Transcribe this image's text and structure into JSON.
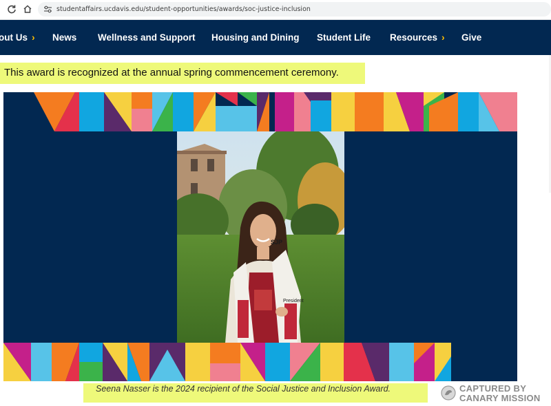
{
  "browser": {
    "url": "studentaffairs.ucdavis.edu/student-opportunities/awards/soc-justice-inclusion",
    "reload_icon": "reload-icon",
    "home_icon": "home-icon",
    "site_settings_icon": "tune-icon"
  },
  "nav": {
    "items": [
      {
        "label": "out Us",
        "has_chevron": true
      },
      {
        "label": "News",
        "has_chevron": false
      },
      {
        "label": "Wellness and Support",
        "has_chevron": false
      },
      {
        "label": "Housing and Dining",
        "has_chevron": false
      },
      {
        "label": "Student Life",
        "has_chevron": false
      },
      {
        "label": "Resources",
        "has_chevron": true
      },
      {
        "label": "Give",
        "has_chevron": false
      }
    ],
    "chevron": "›",
    "bg_color": "#022851",
    "chevron_color": "#ffbf00"
  },
  "content": {
    "intro": "This award is recognized at the annual spring commencement ceremony.",
    "caption": "Seena Nasser is the 2024 recipient of the Social Justice and Inclusion Award.",
    "highlight_color": "#eef97a"
  },
  "photo": {
    "stole_text": "SJP",
    "stole_text_2": "President"
  },
  "watermark": {
    "line1": "CAPTURED BY",
    "line2": "CANARY MISSION"
  }
}
